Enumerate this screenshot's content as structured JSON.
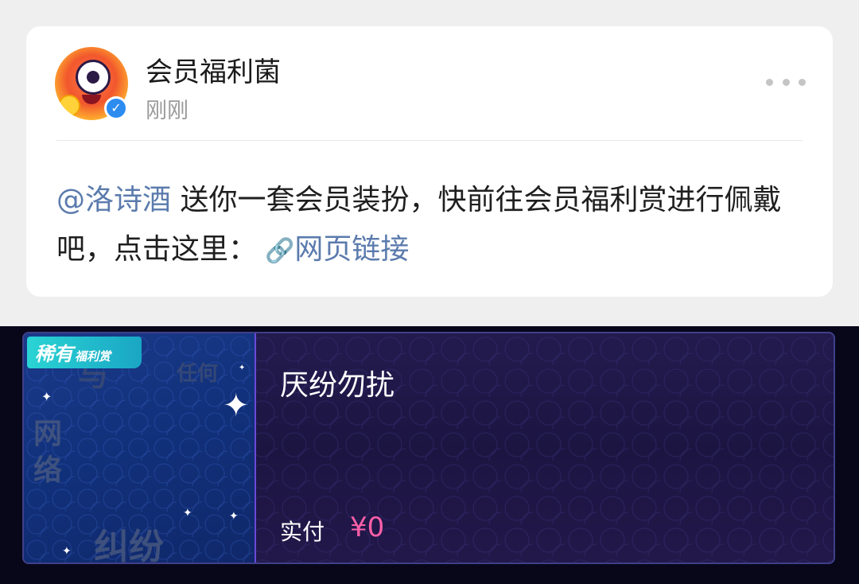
{
  "post": {
    "author": "会员福利菌",
    "time": "刚刚",
    "mention": "@洛诗酒",
    "body": " 送你一套会员装扮，快前往会员福利赏进行佩戴吧，点击这里：",
    "link_text": "网页链接"
  },
  "product": {
    "badge_main": "稀有",
    "badge_sub": "福利赏",
    "thumb_words": [
      "与",
      "任何",
      "网络",
      "纠纷"
    ],
    "title": "厌纷勿扰",
    "price_label": "实付",
    "price_value": "¥0"
  },
  "colors": {
    "link": "#5b7bad",
    "price": "#ff5fa8",
    "card_bg": "#1c1542"
  },
  "icons": {
    "more": "more-dots-icon",
    "verified": "verified-icon",
    "link": "link-icon",
    "sparkle": "sparkle-icon"
  }
}
